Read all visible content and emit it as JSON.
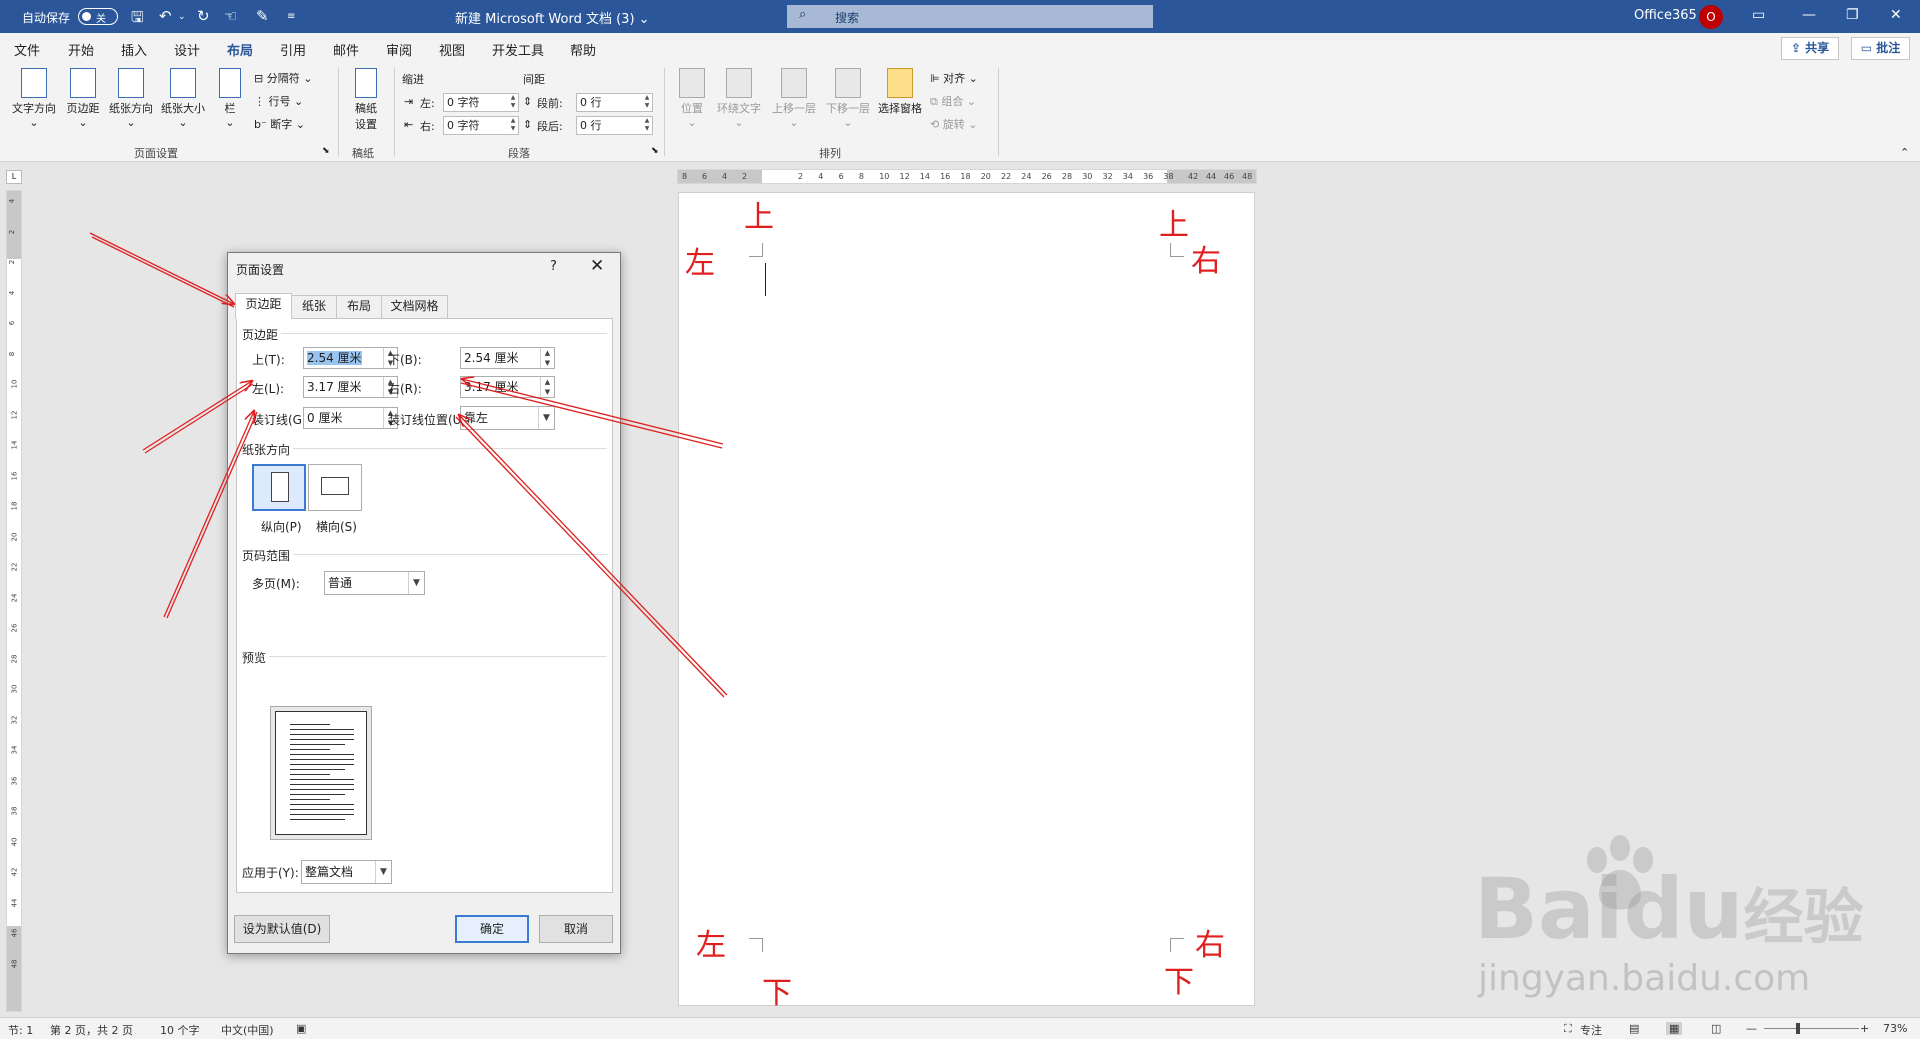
{
  "titlebar": {
    "autosave_label": "自动保存",
    "autosave_state": "关",
    "doc_title": "新建 Microsoft Word 文档 (3) ⌄",
    "search_placeholder": "搜索",
    "account": "Office365",
    "avatar_initial": "O"
  },
  "menu": {
    "tabs": [
      "文件",
      "开始",
      "插入",
      "设计",
      "布局",
      "引用",
      "邮件",
      "审阅",
      "视图",
      "开发工具",
      "帮助"
    ],
    "active": "布局",
    "share": "共享",
    "comment": "批注"
  },
  "ribbon": {
    "page_setup": {
      "text_direction": "文字方向",
      "margins": "页边距",
      "orientation": "纸张方向",
      "size": "纸张大小",
      "columns": "栏",
      "breaks": "分隔符",
      "line_numbers": "行号",
      "hyphenation": "断字",
      "label": "页面设置"
    },
    "manuscript": {
      "button": "稿纸\n设置",
      "label": "稿纸"
    },
    "paragraph": {
      "indent_title": "缩进",
      "spacing_title": "间距",
      "left_label": "左:",
      "left_value": "0 字符",
      "right_label": "右:",
      "right_value": "0 字符",
      "before_label": "段前:",
      "before_value": "0 行",
      "after_label": "段后:",
      "after_value": "0 行",
      "label": "段落"
    },
    "arrange": {
      "position": "位置",
      "wrap_text": "环绕文字",
      "bring_forward": "上移一层",
      "send_backward": "下移一层",
      "selection_pane": "选择窗格",
      "align": "对齐",
      "group": "组合",
      "rotate": "旋转",
      "label": "排列"
    }
  },
  "hruler": {
    "left_nums": [
      "8",
      "6",
      "4",
      "2"
    ],
    "right_nums": [
      "2",
      "4",
      "6",
      "8",
      "10",
      "12",
      "14",
      "16",
      "18",
      "20",
      "22",
      "24",
      "26",
      "28",
      "30",
      "32",
      "34",
      "36",
      "38"
    ],
    "margin_nums": [
      "42",
      "44",
      "46",
      "48"
    ]
  },
  "vruler": {
    "nums": [
      "4",
      "2",
      "2",
      "4",
      "6",
      "8",
      "10",
      "12",
      "14",
      "16",
      "18",
      "20",
      "22",
      "24",
      "26",
      "28",
      "30",
      "32",
      "34",
      "36",
      "38",
      "40",
      "42",
      "44",
      "46",
      "48"
    ]
  },
  "annotations": {
    "top_left": "上",
    "left_top": "左",
    "top_right": "上",
    "right_top": "右",
    "left_bottom": "左",
    "bottom_left": "下",
    "right_bottom": "右",
    "bottom_right": "下"
  },
  "dialog": {
    "title": "页面设置",
    "help": "?",
    "close": "✕",
    "tabs": [
      "页边距",
      "纸张",
      "布局",
      "文档网格"
    ],
    "margins_section": "页边距",
    "top_label": "上(T):",
    "top_value": "2.54 厘米",
    "bottom_label": "下(B):",
    "bottom_value": "2.54 厘米",
    "left_label": "左(L):",
    "left_value": "3.17 厘米",
    "right_label": "右(R):",
    "right_value": "3.17 厘米",
    "gutter_label": "装订线(G):",
    "gutter_value": "0 厘米",
    "gutter_pos_label": "装订线位置(U):",
    "gutter_pos_value": "靠左",
    "orientation_section": "纸张方向",
    "portrait": "纵向(P)",
    "landscape": "横向(S)",
    "pages_section": "页码范围",
    "multiple_pages_label": "多页(M):",
    "multiple_pages_value": "普通",
    "preview_section": "预览",
    "apply_to_label": "应用于(Y):",
    "apply_to_value": "整篇文档",
    "set_default": "设为默认值(D)",
    "ok": "确定",
    "cancel": "取消"
  },
  "statusbar": {
    "section": "节: 1",
    "page": "第 2 页，共 2 页",
    "words": "10 个字",
    "language": "中文(中国)",
    "focus": "专注",
    "zoom": "73%"
  },
  "watermark": {
    "brand": "Bai",
    "suffix": "du",
    "jingyan": "经验",
    "url": "jingyan.baidu.com"
  }
}
